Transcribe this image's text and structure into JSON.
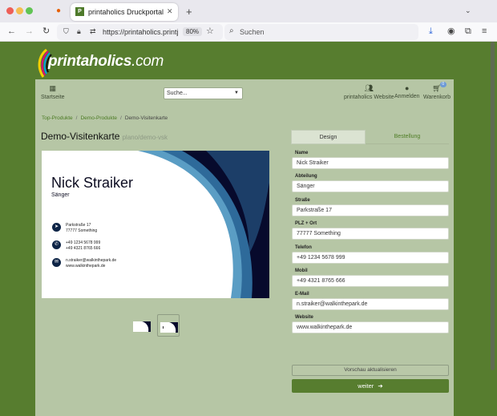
{
  "browser": {
    "tab_title": "printaholics Druckportal",
    "url": "https://printaholics.printj",
    "zoom": "80%",
    "search_placeholder": "Suchen"
  },
  "logo": {
    "name": "printaholics",
    "suffix": ".com"
  },
  "nav": {
    "home_label": "Startseite",
    "search_value": "Suche...",
    "website_label": "printaholics Website",
    "login_label": "Anmelden",
    "cart_label": "Warenkorb",
    "cart_count": "0"
  },
  "breadcrumb": [
    "Top-Produkte",
    "Demo-Produkte",
    "Demo-Visitenkarte"
  ],
  "product": {
    "title": "Demo-Visitenkarte",
    "subtitle": "plano/demo-vsk"
  },
  "card": {
    "name": "Nick Straiker",
    "job": "Sänger",
    "address_1": "Parkstraße 17",
    "address_2": "77777 Something",
    "phone": "+49 1234 5678 999",
    "mobile": "+49 4321 8765 666",
    "email": "n.straiker@walkinthepark.de",
    "website": "www.walkinthepark.de",
    "colors": {
      "navy": "#070a2c",
      "blue": "#2e6a9a",
      "light_blue": "#5a9dc4"
    }
  },
  "tabs": {
    "design": "Design",
    "order": "Bestellung"
  },
  "form": {
    "fields": [
      {
        "label": "Name",
        "value": "Nick Straiker"
      },
      {
        "label": "Abteilung",
        "value": "Sänger"
      },
      {
        "label": "Straße",
        "value": "Parkstraße 17"
      },
      {
        "label": "PLZ + Ort",
        "value": "77777 Something"
      },
      {
        "label": "Telefon",
        "value": "+49 1234 5678 999"
      },
      {
        "label": "Mobil",
        "value": "+49 4321 8765 666"
      },
      {
        "label": "E-Mail",
        "value": "n.straiker@walkinthepark.de"
      },
      {
        "label": "Website",
        "value": "www.walkinthepark.de"
      }
    ],
    "preview_button": "Vorschau aktualisieren",
    "next_button": "weiter"
  }
}
